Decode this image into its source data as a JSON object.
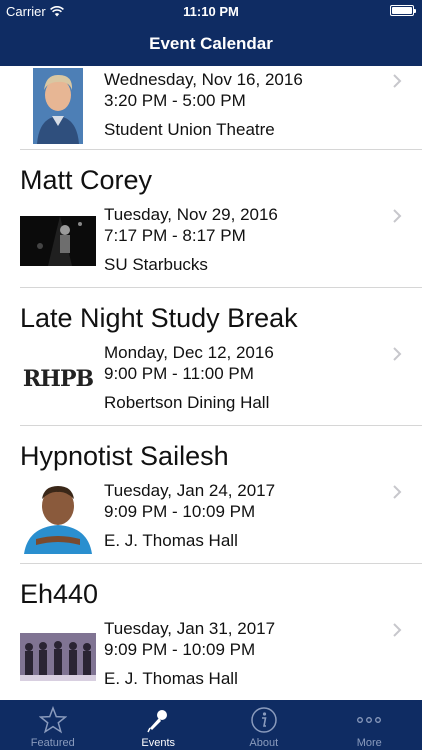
{
  "status": {
    "carrier": "Carrier",
    "time": "11:10 PM",
    "battery_level": 1.0
  },
  "header": {
    "title": "Event Calendar"
  },
  "events": [
    {
      "name": "",
      "date": "Wednesday, Nov 16, 2016",
      "time": "3:20 PM - 5:00 PM",
      "venue": "Student Union Theatre",
      "thumb": "person-portrait"
    },
    {
      "name": "Matt Corey",
      "date": "Tuesday, Nov 29, 2016",
      "time": "7:17 PM - 8:17 PM",
      "venue": "SU Starbucks",
      "thumb": "stage-performer-photo"
    },
    {
      "name": "Late Night Study Break",
      "date": "Monday, Dec 12, 2016",
      "time": "9:00 PM - 11:00 PM",
      "venue": "Robertson Dining Hall",
      "thumb": "rhpb-logo",
      "thumb_text": "RHPB"
    },
    {
      "name": "Hypnotist Sailesh",
      "date": "Tuesday, Jan 24, 2017",
      "time": "9:09 PM - 10:09 PM",
      "venue": "E. J. Thomas Hall",
      "thumb": "person-portrait"
    },
    {
      "name": "Eh440",
      "date": "Tuesday, Jan 31, 2017",
      "time": "9:09 PM - 10:09 PM",
      "venue": "E. J. Thomas Hall",
      "thumb": "group-photo"
    }
  ],
  "tabs": [
    {
      "label": "Featured",
      "icon": "star-icon",
      "active": false
    },
    {
      "label": "Events",
      "icon": "microphone-icon",
      "active": true
    },
    {
      "label": "About",
      "icon": "info-icon",
      "active": false
    },
    {
      "label": "More",
      "icon": "more-icon",
      "active": false
    }
  ],
  "colors": {
    "bar": "#0f2c63",
    "tab_inactive": "#8a9bbd",
    "tab_active": "#ffffff",
    "separator": "#d6d6d6"
  }
}
